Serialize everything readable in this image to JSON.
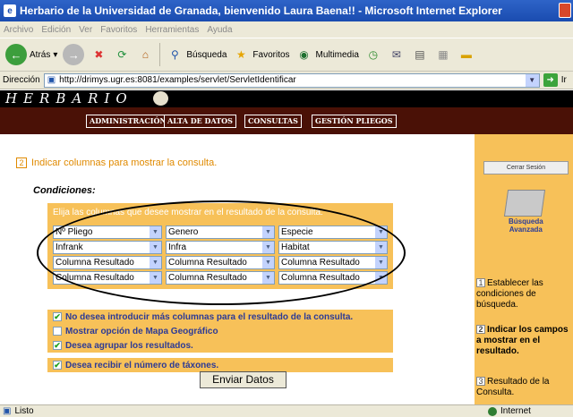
{
  "window": {
    "title": "Herbario de la Universidad de Granada, bienvenido Laura Baena!! - Microsoft Internet Explorer"
  },
  "menu": [
    "Archivo",
    "Edición",
    "Ver",
    "Favoritos",
    "Herramientas",
    "Ayuda"
  ],
  "toolbar": {
    "back": "Atrás",
    "search": "Búsqueda",
    "favorites": "Favoritos",
    "media": "Multimedia",
    "links": "Ir"
  },
  "address": {
    "label": "Dirección",
    "url": "http://drimys.ugr.es:8081/examples/servlet/ServletIdentificar",
    "go": "Ir"
  },
  "site": {
    "title": "HERBARIO",
    "nav": [
      "ADMINISTRACIÓN",
      "ALTA DE DATOS",
      "CONSULTAS",
      "GESTIÓN PLIEGOS"
    ]
  },
  "main": {
    "step_num": "2",
    "heading": "Indicar columnas para mostrar la consulta.",
    "conditions_label": "Condiciones:",
    "hint": "Elija las columnas que desee mostrar en el resultado de la consulta:",
    "selects": [
      [
        "Nº Pliego",
        "Genero",
        "Especie"
      ],
      [
        "Infrank",
        "Infra",
        "Habitat"
      ],
      [
        "Columna Resultado",
        "Columna Resultado",
        "Columna Resultado"
      ],
      [
        "Columna Resultado",
        "Columna Resultado",
        "Columna Resultado"
      ]
    ],
    "options": [
      {
        "label": "No desea introducir más columnas para el resultado de la consulta.",
        "checked": true
      },
      {
        "label": "Mostrar opción de Mapa Geográfico",
        "checked": false
      },
      {
        "label": "Desea agrupar los resultados.",
        "checked": true
      },
      {
        "label": "Desea recibir el número de táxones.",
        "checked": true
      }
    ],
    "submit": "Enviar Datos"
  },
  "sidebar": {
    "logout": "Cerrar Sesión",
    "search_label_1": "Búsqueda",
    "search_label_2": "Avanzada",
    "steps": [
      {
        "num": "1",
        "text": "Establecer las condiciones de búsqueda."
      },
      {
        "num": "2",
        "text": "Indicar los campos a mostrar en el resultado."
      },
      {
        "num": "3",
        "text": "Resultado de la Consulta."
      }
    ]
  },
  "status": {
    "text": "Listo",
    "zone": "Internet"
  },
  "colors": {
    "panel": "#f7c159",
    "navband": "#4a1106",
    "accent": "#e08a00",
    "label_blue": "#2c3a96"
  }
}
